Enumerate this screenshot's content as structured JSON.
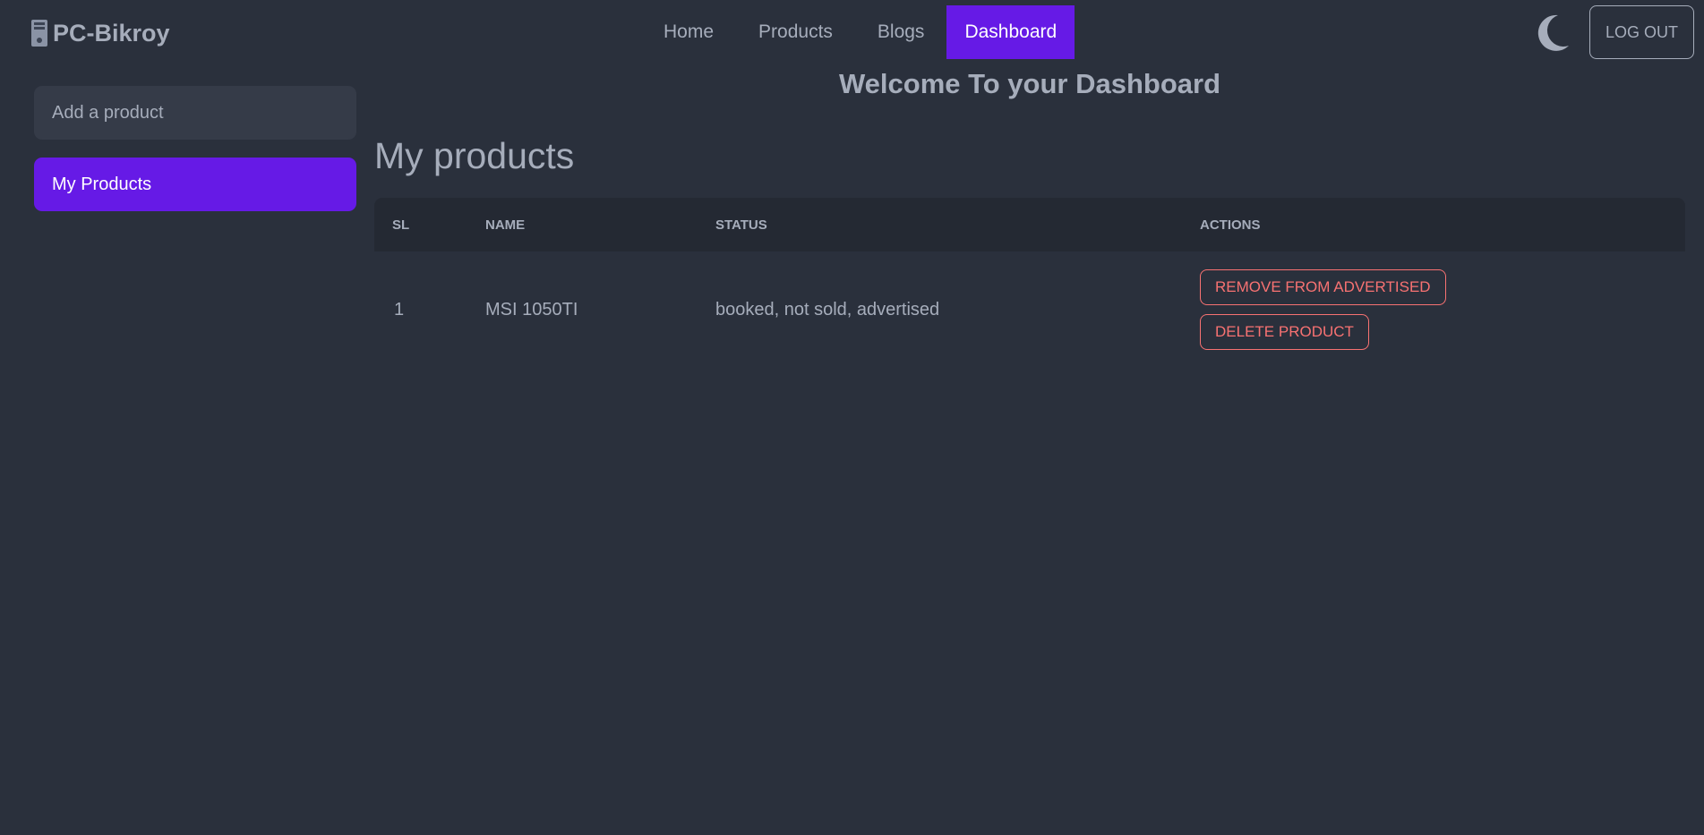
{
  "navbar": {
    "brand": "PC-Bikroy",
    "links": [
      "Home",
      "Products",
      "Blogs",
      "Dashboard"
    ],
    "active_link": "Dashboard",
    "logout_label": "LOG OUT"
  },
  "sidebar": {
    "items": [
      {
        "label": "Add a product",
        "active": false
      },
      {
        "label": "My Products",
        "active": true
      }
    ]
  },
  "main": {
    "welcome": "Welcome To your Dashboard",
    "section_title": "My products",
    "table": {
      "headers": [
        "SL",
        "NAME",
        "STATUS",
        "ACTIONS"
      ],
      "rows": [
        {
          "sl": "1",
          "name": "MSI 1050TI",
          "status": "booked, not sold, advertised",
          "actions": [
            "REMOVE FROM ADVERTISED",
            "DELETE PRODUCT"
          ]
        }
      ]
    }
  },
  "colors": {
    "background": "#2a303c",
    "primary": "#661ae6",
    "error": "#f87272",
    "text": "#a6adbb"
  },
  "icons": {
    "brand": "computer-tower-icon",
    "theme": "moon-icon"
  }
}
